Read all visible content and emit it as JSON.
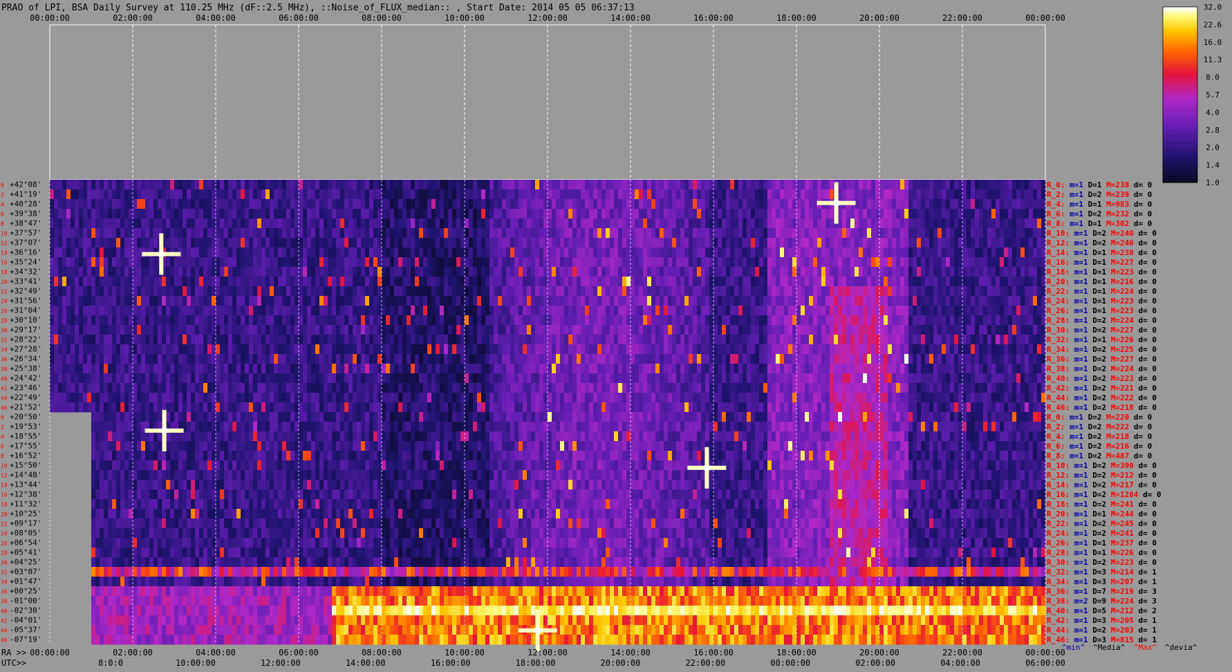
{
  "title": "PRAO of LPI, BSA Daily Survey at 110.25 MHz (dF::2.5 MHz), ::Noise_of_FLUX_median:: , Start Date: 2014 05 05 06:37:13",
  "colors": {
    "background": "#9a9a9a",
    "axis_text": "#000000",
    "row_index": "#ff0000",
    "stat_label": "#ff0000",
    "stat_value": "#0000aa"
  },
  "chart_data": {
    "type": "heatmap",
    "colormap": "black-blue-purple-red-orange-yellow-white",
    "top_time_ticks": [
      "00:00:00",
      "02:00:00",
      "04:00:00",
      "06:00:00",
      "08:00:00",
      "10:00:00",
      "12:00:00",
      "14:00:00",
      "16:00:00",
      "18:00:00",
      "20:00:00",
      "22:00:00",
      "00:00:00"
    ],
    "bottom_ra_label": "RA >>",
    "bottom_ra_ticks": [
      "00:00:00",
      "02:00:00",
      "04:00:00",
      "06:00:00",
      "08:00:00",
      "10:00:00",
      "12:00:00",
      "14:00:00",
      "16:00:00",
      "18:00:00",
      "20:00:00",
      "22:00:00",
      "00:00:00"
    ],
    "bottom_utc_label": "UTC>>",
    "bottom_utc_ticks": [
      "8:0:0",
      "10:00:00",
      "12:00:00",
      "14:00:00",
      "16:00:00",
      "18:00:00",
      "20:00:00",
      "22:00:00",
      "00:00:00",
      "02:00:00",
      "04:00:00",
      "06:00:00"
    ],
    "colorbar_ticks": [
      "32.0",
      "22.6",
      "16.0",
      "11.3",
      "8.0",
      "5.7",
      "4.0",
      "2.8",
      "2.0",
      "1.4",
      "1.0"
    ],
    "colorbar_range": [
      1.0,
      32.0
    ],
    "colorbar_scale": "log",
    "declinations": [
      "+42°08'",
      "+41°19'",
      "+40°28'",
      "+39°38'",
      "+38°47'",
      "+37°57'",
      "+37°07'",
      "+36°16'",
      "+35°24'",
      "+34°32'",
      "+33°41'",
      "+32°49'",
      "+31°56'",
      "+31°04'",
      "+30°10'",
      "+29°17'",
      "+28°22'",
      "+27°28'",
      "+26°34'",
      "+25°38'",
      "+24°42'",
      "+23°46'",
      "+22°49'",
      "+21°52'",
      "+20°50'",
      "+19°53'",
      "+18°55'",
      "+17°55'",
      "+16°52'",
      "+15°50'",
      "+14°48'",
      "+13°44'",
      "+12°38'",
      "+11°32'",
      "+10°25'",
      "+09°17'",
      "+08°05'",
      "+06°54'",
      "+05°41'",
      "+04°25'",
      "+03°07'",
      "+01°47'",
      "+00°25'",
      "-01°00'",
      "-02°30'",
      "-04°01'",
      "-05°37'",
      "-07°19'"
    ],
    "row_indices_top": [
      "0",
      "2",
      "4",
      "6",
      "8",
      "10",
      "12",
      "14",
      "16",
      "18",
      "20",
      "22",
      "24",
      "26",
      "28",
      "30",
      "32",
      "34",
      "36",
      "38",
      "40",
      "42",
      "44",
      "46"
    ],
    "row_indices_bottom": [
      "0",
      "2",
      "4",
      "6",
      "8",
      "10",
      "12",
      "14",
      "16",
      "18",
      "20",
      "22",
      "24",
      "26",
      "28",
      "30",
      "32",
      "34",
      "36",
      "38",
      "40",
      "42",
      "44",
      "46"
    ],
    "row_stats": [
      {
        "r": "R_0:",
        "m": "m=1",
        "D": "D=1",
        "M": "M=238",
        "d": "d= 0"
      },
      {
        "r": "R_2:",
        "m": "m=1",
        "D": "D=2",
        "M": "M=239",
        "d": "d= 0"
      },
      {
        "r": "R_4:",
        "m": "m=1",
        "D": "D=1",
        "M": "M=983",
        "d": "d= 0"
      },
      {
        "r": "R_6:",
        "m": "m=1",
        "D": "D=2",
        "M": "M=232",
        "d": "d= 0"
      },
      {
        "r": "R_8:",
        "m": "m=1",
        "D": "D=1",
        "M": "M=302",
        "d": "d= 0"
      },
      {
        "r": "R_10:",
        "m": "m=1",
        "D": "D=2",
        "M": "M=240",
        "d": "d= 0"
      },
      {
        "r": "R_12:",
        "m": "m=1",
        "D": "D=2",
        "M": "M=240",
        "d": "d= 0"
      },
      {
        "r": "R_14:",
        "m": "m=1",
        "D": "D=1",
        "M": "M=238",
        "d": "d= 0"
      },
      {
        "r": "R_16:",
        "m": "m=1",
        "D": "D=1",
        "M": "M=227",
        "d": "d= 0"
      },
      {
        "r": "R_18:",
        "m": "m=1",
        "D": "D=1",
        "M": "M=223",
        "d": "d= 0"
      },
      {
        "r": "R_20:",
        "m": "m=1",
        "D": "D=1",
        "M": "M=216",
        "d": "d= 0"
      },
      {
        "r": "R_22:",
        "m": "m=1",
        "D": "D=1",
        "M": "M=224",
        "d": "d= 0"
      },
      {
        "r": "R_24:",
        "m": "m=1",
        "D": "D=1",
        "M": "M=223",
        "d": "d= 0"
      },
      {
        "r": "R_26:",
        "m": "m=1",
        "D": "D=1",
        "M": "M=223",
        "d": "d= 0"
      },
      {
        "r": "R_28:",
        "m": "m=1",
        "D": "D=2",
        "M": "M=224",
        "d": "d= 0"
      },
      {
        "r": "R_30:",
        "m": "m=1",
        "D": "D=2",
        "M": "M=227",
        "d": "d= 0"
      },
      {
        "r": "R_32:",
        "m": "m=1",
        "D": "D=1",
        "M": "M=226",
        "d": "d= 0"
      },
      {
        "r": "R_34:",
        "m": "m=1",
        "D": "D=2",
        "M": "M=225",
        "d": "d= 0"
      },
      {
        "r": "R_36:",
        "m": "m=1",
        "D": "D=2",
        "M": "M=227",
        "d": "d= 0"
      },
      {
        "r": "R_38:",
        "m": "m=1",
        "D": "D=2",
        "M": "M=224",
        "d": "d= 0"
      },
      {
        "r": "R_40:",
        "m": "m=1",
        "D": "D=2",
        "M": "M=223",
        "d": "d= 0"
      },
      {
        "r": "R_42:",
        "m": "m=1",
        "D": "D=2",
        "M": "M=221",
        "d": "d= 0"
      },
      {
        "r": "R_44:",
        "m": "m=1",
        "D": "D=2",
        "M": "M=222",
        "d": "d= 0"
      },
      {
        "r": "R_46:",
        "m": "m=1",
        "D": "D=2",
        "M": "M=218",
        "d": "d= 0"
      },
      {
        "r": "R_0:",
        "m": "m=1",
        "D": "D=2",
        "M": "M=220",
        "d": "d= 0"
      },
      {
        "r": "R_2:",
        "m": "m=1",
        "D": "D=2",
        "M": "M=222",
        "d": "d= 0"
      },
      {
        "r": "R_4:",
        "m": "m=1",
        "D": "D=2",
        "M": "M=218",
        "d": "d= 0"
      },
      {
        "r": "R_6:",
        "m": "m=1",
        "D": "D=2",
        "M": "M=216",
        "d": "d= 0"
      },
      {
        "r": "R_8:",
        "m": "m=1",
        "D": "D=2",
        "M": "M=487",
        "d": "d= 0"
      },
      {
        "r": "R_10:",
        "m": "m=1",
        "D": "D=2",
        "M": "M=390",
        "d": "d= 0"
      },
      {
        "r": "R_12:",
        "m": "m=1",
        "D": "D=2",
        "M": "M=212",
        "d": "d= 0"
      },
      {
        "r": "R_14:",
        "m": "m=1",
        "D": "D=2",
        "M": "M=217",
        "d": "d= 0"
      },
      {
        "r": "R_16:",
        "m": "m=1",
        "D": "D=2",
        "M": "M=1284",
        "d": "d= 0"
      },
      {
        "r": "R_18:",
        "m": "m=1",
        "D": "D=2",
        "M": "M=241",
        "d": "d= 0"
      },
      {
        "r": "R_20:",
        "m": "m=1",
        "D": "D=1",
        "M": "M=244",
        "d": "d= 0"
      },
      {
        "r": "R_22:",
        "m": "m=1",
        "D": "D=2",
        "M": "M=245",
        "d": "d= 0"
      },
      {
        "r": "R_24:",
        "m": "m=1",
        "D": "D=2",
        "M": "M=241",
        "d": "d= 0"
      },
      {
        "r": "R_26:",
        "m": "m=1",
        "D": "D=1",
        "M": "M=237",
        "d": "d= 0"
      },
      {
        "r": "R_28:",
        "m": "m=1",
        "D": "D=1",
        "M": "M=226",
        "d": "d= 0"
      },
      {
        "r": "R_30:",
        "m": "m=1",
        "D": "D=2",
        "M": "M=223",
        "d": "d= 0"
      },
      {
        "r": "R_32:",
        "m": "m=1",
        "D": "D=3",
        "M": "M=214",
        "d": "d= 1"
      },
      {
        "r": "R_34:",
        "m": "m=1",
        "D": "D=3",
        "M": "M=207",
        "d": "d= 1"
      },
      {
        "r": "R_36:",
        "m": "m=1",
        "D": "D=7",
        "M": "M=219",
        "d": "d= 3"
      },
      {
        "r": "R_38:",
        "m": "m=2",
        "D": "D=9",
        "M": "M=224",
        "d": "d= 3"
      },
      {
        "r": "R_40:",
        "m": "m=1",
        "D": "D=5",
        "M": "M=212",
        "d": "d= 2"
      },
      {
        "r": "R_42:",
        "m": "m=1",
        "D": "D=3",
        "M": "M=205",
        "d": "d= 1"
      },
      {
        "r": "R_44:",
        "m": "m=1",
        "D": "D=2",
        "M": "M=203",
        "d": "d= 1"
      },
      {
        "r": "R_46:",
        "m": "m=1",
        "D": "D=3",
        "M": "M=815",
        "d": "d= 1"
      }
    ],
    "legend_keys": [
      {
        "label": "^min^",
        "color": "#0000aa"
      },
      {
        "label": "^Media^",
        "color": "#000000"
      },
      {
        "label": "^Max^",
        "color": "#ff0000"
      },
      {
        "label": "^devia^",
        "color": "#000000"
      }
    ]
  }
}
